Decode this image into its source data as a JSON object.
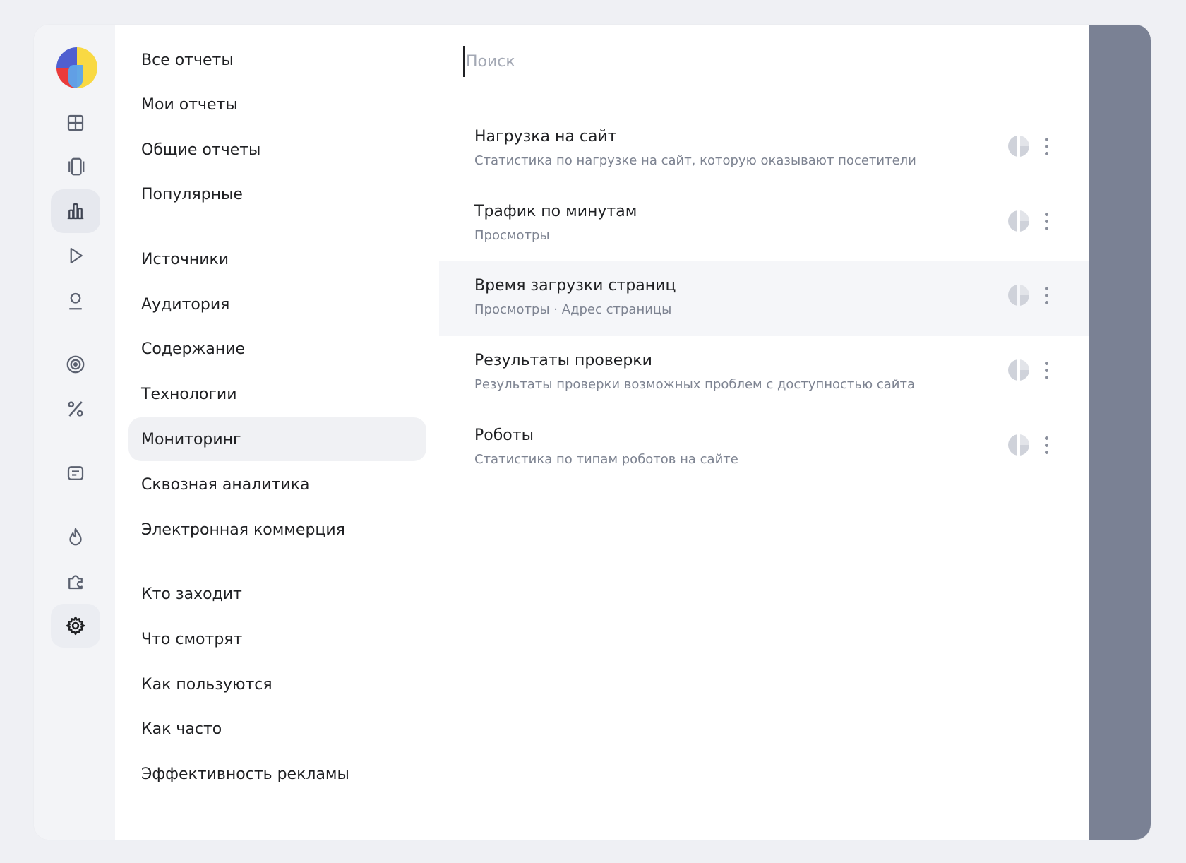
{
  "sidebar_icons": [
    {
      "name": "dashboard-icon"
    },
    {
      "name": "device-icon"
    },
    {
      "name": "reports-icon",
      "active": true
    },
    {
      "name": "play-icon"
    },
    {
      "name": "user-icon"
    },
    {
      "name": "target-icon"
    },
    {
      "name": "percent-icon"
    },
    {
      "name": "list-icon"
    },
    {
      "name": "fire-icon"
    },
    {
      "name": "puzzle-icon"
    },
    {
      "name": "gear-icon",
      "active": true
    }
  ],
  "nav": {
    "items": [
      {
        "label": "Все отчеты"
      },
      {
        "label": "Мои отчеты"
      },
      {
        "label": "Общие отчеты"
      },
      {
        "label": "Популярные"
      },
      {
        "label": "Источники"
      },
      {
        "label": "Аудитория"
      },
      {
        "label": "Содержание"
      },
      {
        "label": "Технологии"
      },
      {
        "label": "Мониторинг",
        "selected": true
      },
      {
        "label": "Сквозная аналитика"
      },
      {
        "label": "Электронная коммерция"
      },
      {
        "label": "Кто заходит"
      },
      {
        "label": "Что смотрят"
      },
      {
        "label": "Как пользуются"
      },
      {
        "label": "Как часто"
      },
      {
        "label": "Эффективность рекламы"
      }
    ]
  },
  "search": {
    "placeholder": "Поиск",
    "value": ""
  },
  "reports": [
    {
      "title": "Нагрузка на сайт",
      "subtitle": "Статистика по нагрузке на сайт, которую оказывают посетители"
    },
    {
      "title": "Трафик по минутам",
      "subtitle": "Просмотры"
    },
    {
      "title": "Время загрузки страниц",
      "subtitle": "Просмотры · Адрес страницы",
      "hovered": true
    },
    {
      "title": "Результаты проверки",
      "subtitle": "Результаты проверки возможных проблем с доступностью сайта"
    },
    {
      "title": "Роботы",
      "subtitle": "Статистика по типам роботов на сайте"
    }
  ],
  "colors": {
    "background": "#eff0f4",
    "accent_overlay": "#7a8194",
    "selected_bg": "#f0f1f4",
    "text_primary": "#1f2023",
    "text_secondary": "#7d8391"
  }
}
